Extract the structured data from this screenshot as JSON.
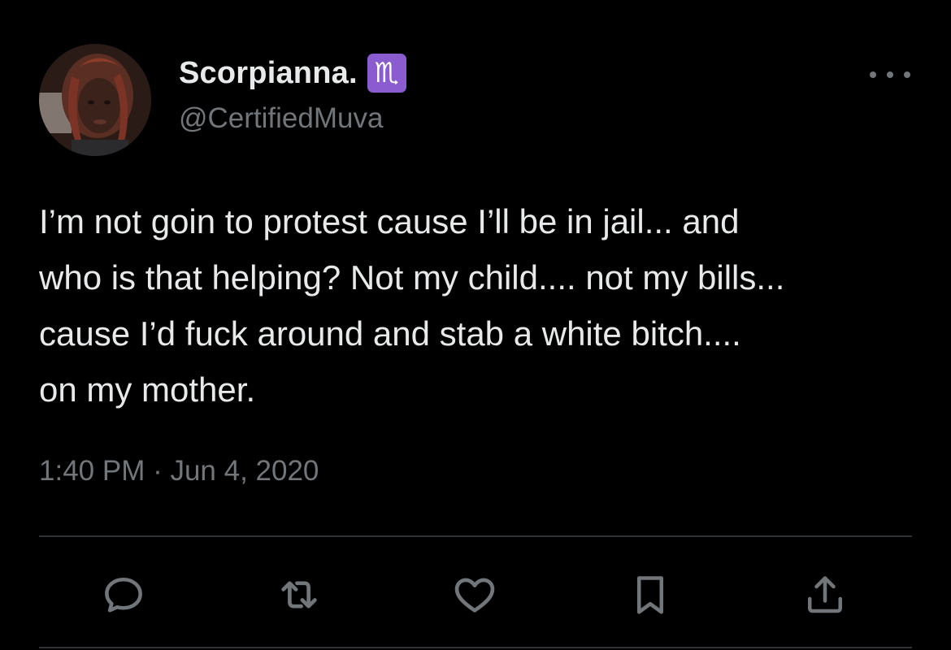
{
  "tweet": {
    "display_name": "Scorpianna.",
    "zodiac_badge": "♏",
    "handle": "@CertifiedMuva",
    "text": "I’m not goin to protest cause I’ll be in jail... and\nwho is that helping? Not my child.... not my bills...\ncause I’d fuck around and stab a white bitch....\non my mother.",
    "timestamp": "1:40 PM · Jun 4, 2020"
  },
  "icons": {
    "more": "more-horizontal-icon",
    "reply": "reply-bubble-icon",
    "retweet": "retweet-icon",
    "like": "heart-icon",
    "bookmark": "bookmark-icon",
    "share": "share-upload-icon"
  },
  "colors": {
    "background": "#000000",
    "text_primary": "#e7e9ea",
    "text_secondary": "#71767b",
    "divider": "#2f3336",
    "zodiac_badge": "#8a5cd0"
  }
}
